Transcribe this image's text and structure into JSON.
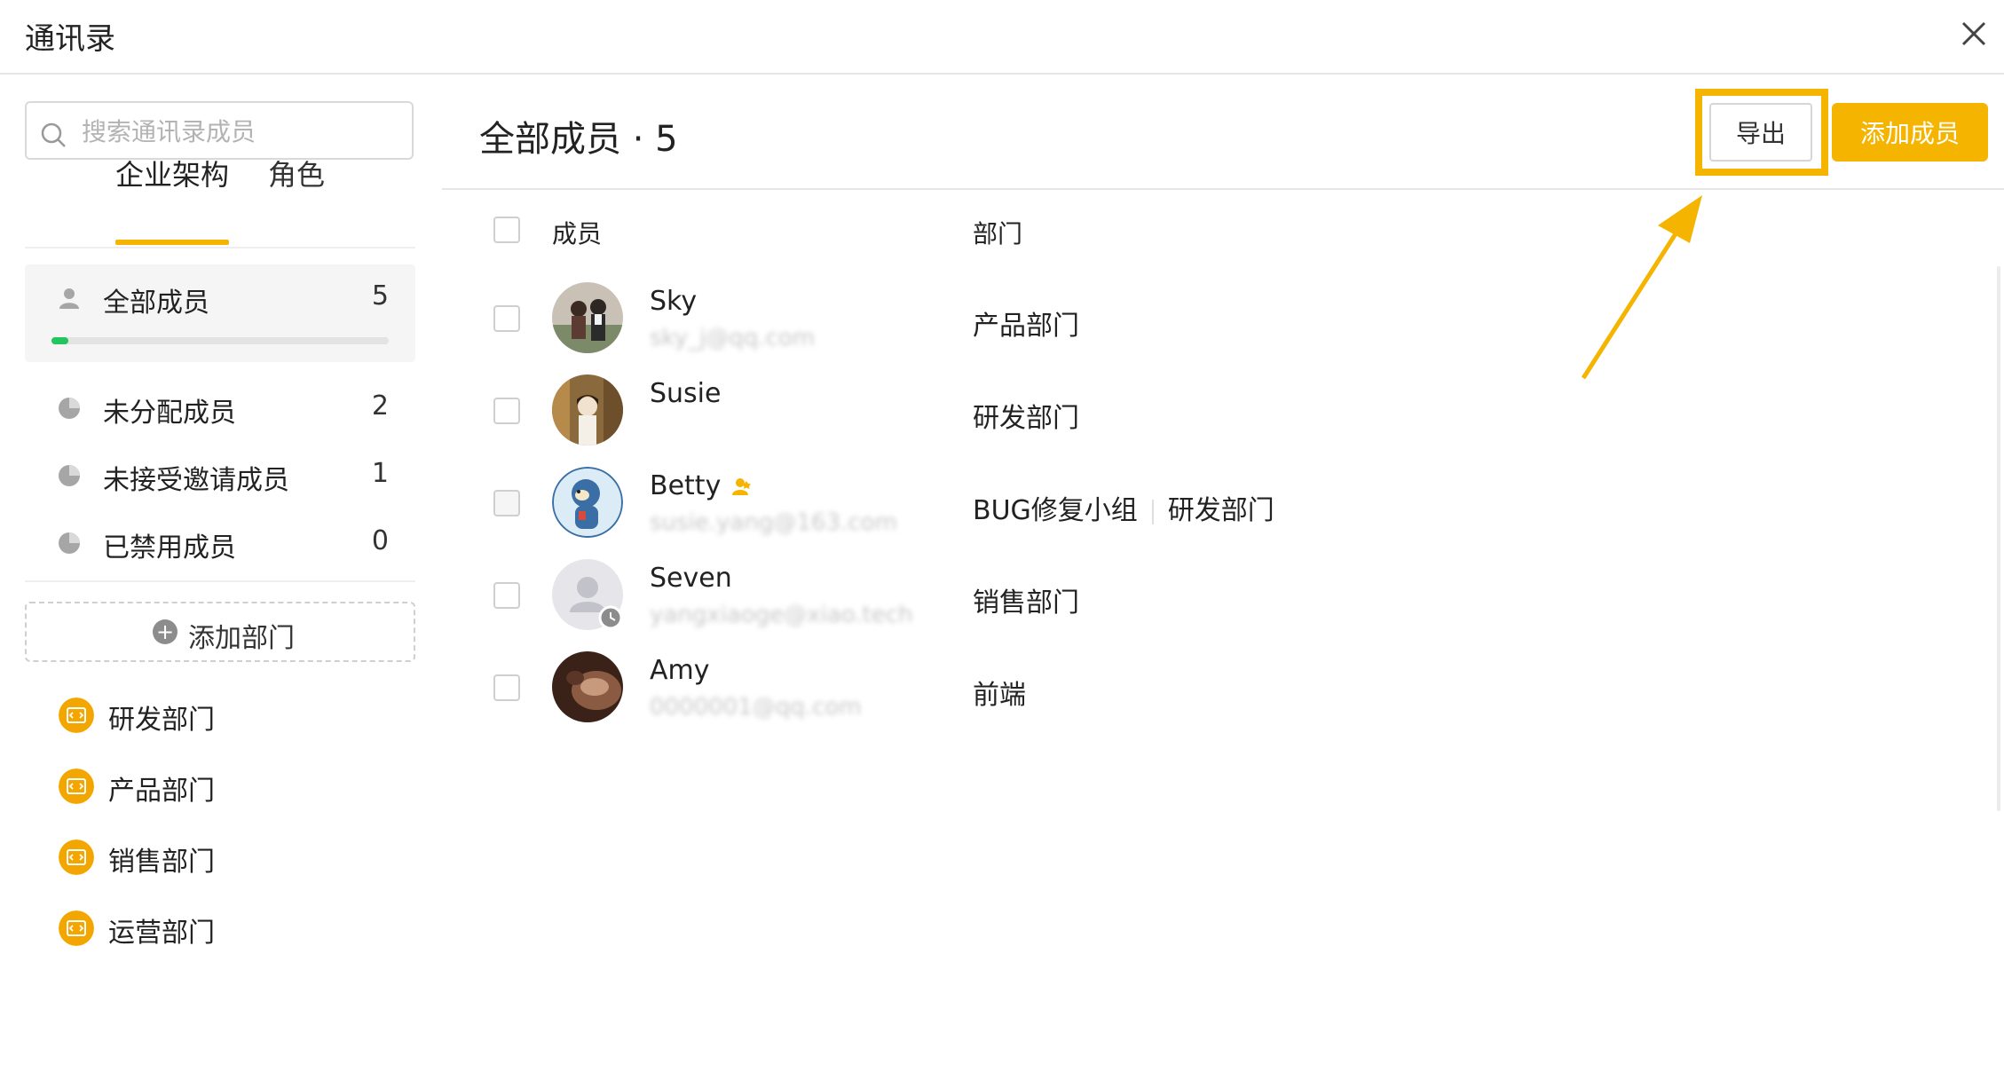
{
  "window": {
    "title": "通讯录"
  },
  "sidebar": {
    "search_placeholder": "搜索通讯录成员",
    "tabs": [
      {
        "label": "企业架构"
      },
      {
        "label": "角色"
      }
    ],
    "groups": [
      {
        "label": "全部成员",
        "count": "5",
        "progress_fraction": 0.05
      },
      {
        "label": "未分配成员",
        "count": "2"
      },
      {
        "label": "未接受邀请成员",
        "count": "1"
      },
      {
        "label": "已禁用成员",
        "count": "0"
      }
    ],
    "add_department_label": "添加部门",
    "departments": [
      {
        "label": "研发部门"
      },
      {
        "label": "产品部门"
      },
      {
        "label": "销售部门"
      },
      {
        "label": "运营部门"
      }
    ]
  },
  "main": {
    "title": "全部成员 · 5",
    "export_label": "导出",
    "add_member_label": "添加成员",
    "columns": {
      "member": "成员",
      "department": "部门"
    },
    "members": [
      {
        "name": "Sky",
        "email": "sky_j@qq.com",
        "department": "产品部门"
      },
      {
        "name": "Susie",
        "email": "",
        "department": "研发部门"
      },
      {
        "name": "Betty",
        "email": "susie.yang@163.com",
        "department": "BUG修复小组",
        "department2": "研发部门",
        "is_admin": true
      },
      {
        "name": "Seven",
        "email": "yangxiaoge@xiao.tech",
        "department": "销售部门"
      },
      {
        "name": "Amy",
        "email": "0000001@qq.com",
        "department": "前端"
      }
    ]
  },
  "colors": {
    "accent": "#f4b400",
    "progress": "#22c55e"
  }
}
